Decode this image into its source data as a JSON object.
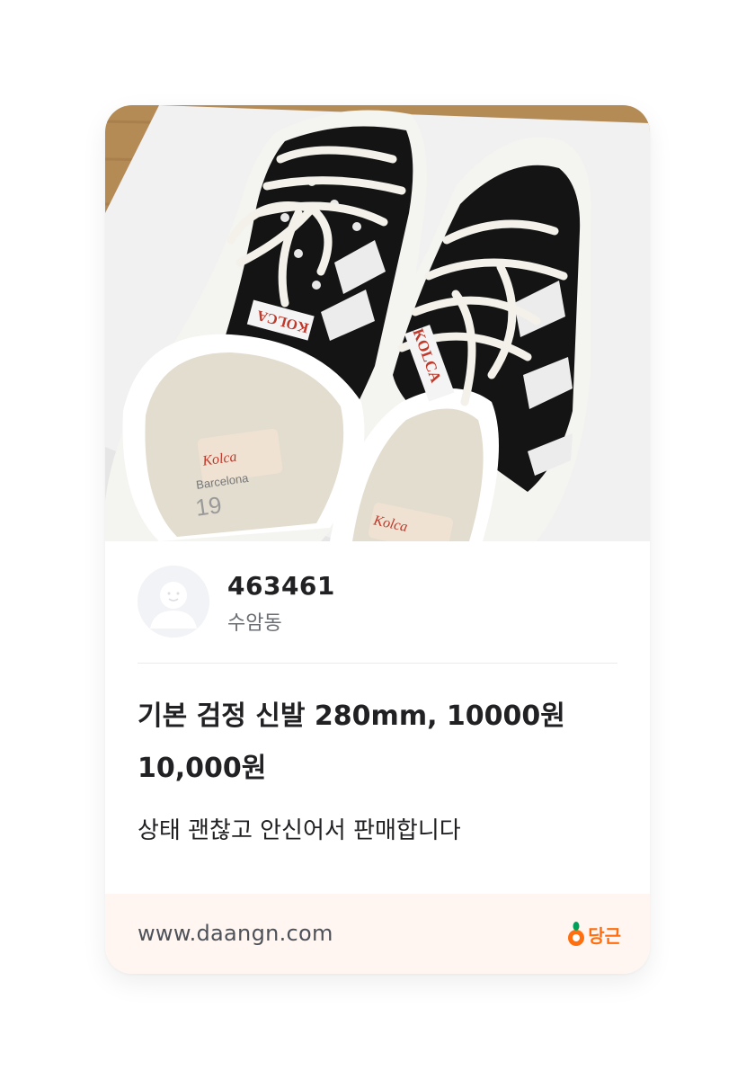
{
  "listing": {
    "nickname": "463461",
    "region": "수암동",
    "title": "기본 검정 신발 280mm, 10000원",
    "price": "10,000원",
    "description": "상태 괜찮고 안신어서 판매합니다"
  },
  "footer": {
    "url": "www.daangn.com",
    "brand": "당근"
  },
  "photo": {
    "shoe_text": "KOLCA",
    "insole_text": "Barcelona"
  },
  "icons": {
    "avatar": "default-user-avatar",
    "brand": "carrot-icon"
  },
  "colors": {
    "brand_orange": "#ff6f0f",
    "footer_bg": "#fff6f1",
    "text_primary": "#212124",
    "text_secondary": "#6b6e73"
  }
}
